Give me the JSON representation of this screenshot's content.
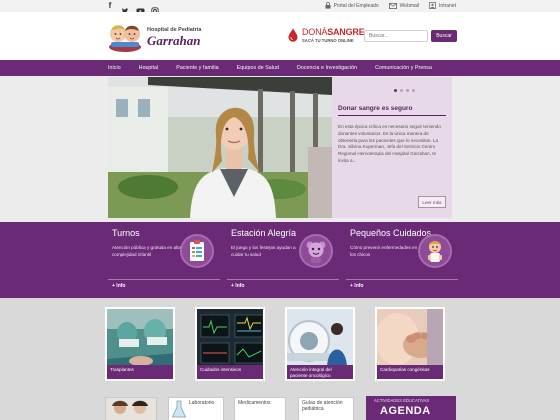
{
  "topbar": {
    "social": [
      "facebook-icon",
      "twitter-icon",
      "youtube-icon",
      "instagram-icon"
    ],
    "links": [
      {
        "label": "Portal del Empleado",
        "icon": "lock-icon"
      },
      {
        "label": "Webmail",
        "icon": "mail-icon"
      },
      {
        "label": "Intranet",
        "icon": "user-icon"
      }
    ]
  },
  "header": {
    "logo_line1": "Hospital de Pediatría",
    "logo_line2": "Garrahan",
    "dona_prefix": "DONÁ",
    "dona_main": "SANGRE",
    "dona_sub": "SACÁ TU TURNO ONLINE",
    "search_placeholder": "Buscar...",
    "search_button": "Buscar"
  },
  "nav": [
    "Inicio",
    "Hospital",
    "Paciente y familia",
    "Equipos de Salud",
    "Docencia e Investigación",
    "Comunicación y Prensa"
  ],
  "news": {
    "title": "Donar sangre es seguro",
    "body": "En esta época crítica es necesario seguir teniendo donantes voluntarios. Es la única manera de obtenerla para los pacientes que lo necesitan. La Dra. Silvina Kuperman, Jefa del Servicio Centro Regional Hemoterapia del Hospital Garrahan, te invita a...",
    "more": "Leer más",
    "slides": 4,
    "active_slide": 1
  },
  "band": [
    {
      "title": "Turnos",
      "text": "Atención pública y gratuita en alta complejidad infantil",
      "more": "+ Info",
      "icon": "clipboard-icon"
    },
    {
      "title": "Estación Alegría",
      "text": "El juego y los festejos ayudan a cuidar tu salud",
      "more": "+ Info",
      "icon": "mascot-icon"
    },
    {
      "title": "Pequeños Cuidados",
      "text": "Cómo prevenir enfermedades en los chicos",
      "more": "+ Info",
      "icon": "child-icon"
    }
  ],
  "tiles": [
    {
      "label": "Trasplantes"
    },
    {
      "label": "Cuidados intensivos"
    },
    {
      "label": "Atención integral del paciente oncológico"
    },
    {
      "label": "Cardiopatías congénitas"
    }
  ],
  "bottom": {
    "cards": [
      "Laboratorio",
      "Medicamentos",
      "Guías de atención pediátrica"
    ],
    "agenda_small": "ACTIVIDADES EDUCATIVAS",
    "agenda_big": "AGENDA"
  },
  "colors": {
    "brand": "#6b2a76",
    "accent_red": "#c7282d"
  }
}
